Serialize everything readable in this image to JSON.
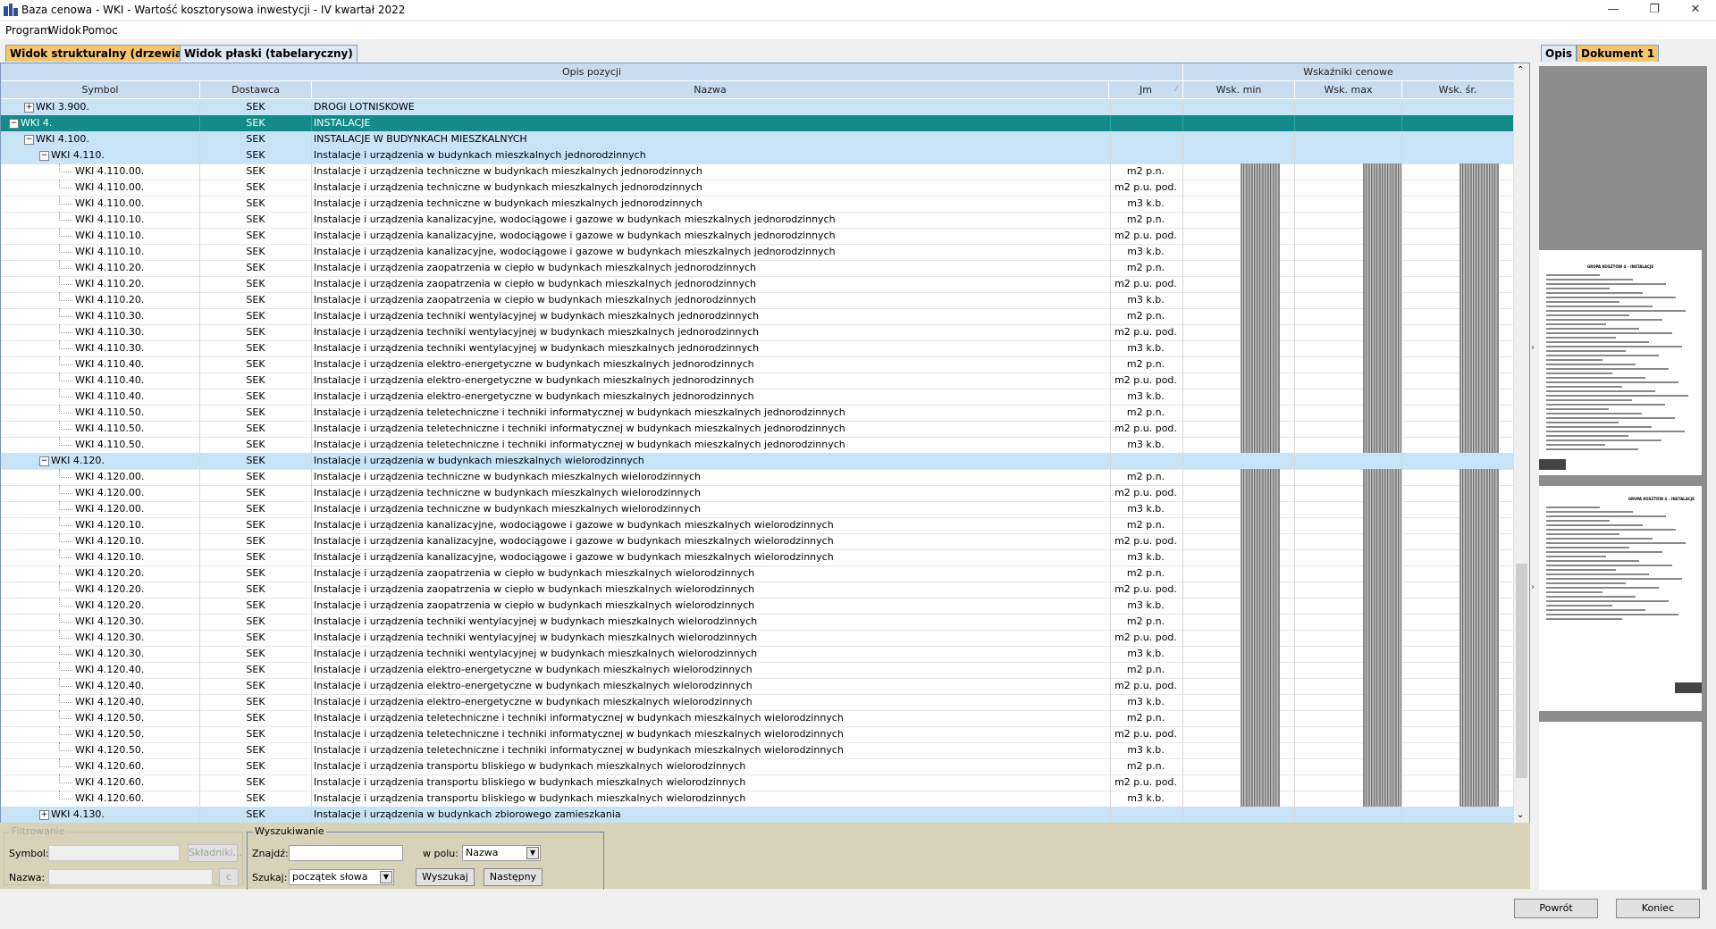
{
  "window": {
    "title": "Baza cenowa - WKI - Wartość kosztorysowa inwestycji - IV kwartał 2022",
    "minimize": "—",
    "restore": "❐",
    "close": "✕"
  },
  "menu": [
    "Program",
    "Widok",
    "Pomoc"
  ],
  "tabs": [
    {
      "label": "Widok strukturalny (drzewiasty)",
      "active": true
    },
    {
      "label": "Widok płaski (tabelaryczny)",
      "active": false
    }
  ],
  "grid": {
    "group_opis": "Opis pozycji",
    "group_wsk": "Wskaźniki cenowe",
    "columns": {
      "symbol": "Symbol",
      "dostawca": "Dostawca",
      "nazwa": "Nazwa",
      "jm": "Jm",
      "wsk_min": "Wsk. min",
      "wsk_max": "Wsk. max",
      "wsk_sr": "Wsk. śr."
    },
    "rows": [
      {
        "symbol": "WKI 3.900.",
        "dostawca": "SEK",
        "nazwa": "DROGI LOTNISKOWE",
        "jm": "",
        "level": 1,
        "type": "grp",
        "exp": "+"
      },
      {
        "symbol": "WKI 4.",
        "dostawca": "SEK",
        "nazwa": "INSTALACJE",
        "jm": "",
        "level": 0,
        "type": "sel",
        "exp": "−"
      },
      {
        "symbol": "WKI 4.100.",
        "dostawca": "SEK",
        "nazwa": "INSTALACJE W BUDYNKACH MIESZKALNYCH",
        "jm": "",
        "level": 1,
        "type": "grp",
        "exp": "−"
      },
      {
        "symbol": "WKI 4.110.",
        "dostawca": "SEK",
        "nazwa": "Instalacje i urządzenia w budynkach mieszkalnych jednorodzinnych",
        "jm": "",
        "level": 2,
        "type": "grp",
        "exp": "−"
      },
      {
        "symbol": "WKI 4.110.00.",
        "dostawca": "SEK",
        "nazwa": "Instalacje i urządzenia techniczne w budynkach mieszkalnych jednorodzinnych",
        "jm": "m2 p.n.",
        "level": 3,
        "type": "leaf"
      },
      {
        "symbol": "WKI 4.110.00.",
        "dostawca": "SEK",
        "nazwa": "Instalacje i urządzenia techniczne w budynkach mieszkalnych jednorodzinnych",
        "jm": "m2 p.u. pod.",
        "level": 3,
        "type": "leaf"
      },
      {
        "symbol": "WKI 4.110.00.",
        "dostawca": "SEK",
        "nazwa": "Instalacje i urządzenia techniczne w budynkach mieszkalnych jednorodzinnych",
        "jm": "m3 k.b.",
        "level": 3,
        "type": "leaf"
      },
      {
        "symbol": "WKI 4.110.10.",
        "dostawca": "SEK",
        "nazwa": "Instalacje i urządzenia kanalizacyjne, wodociągowe i gazowe w budynkach mieszkalnych jednorodzinnych",
        "jm": "m2 p.n.",
        "level": 3,
        "type": "leaf"
      },
      {
        "symbol": "WKI 4.110.10.",
        "dostawca": "SEK",
        "nazwa": "Instalacje i urządzenia kanalizacyjne, wodociągowe i gazowe w budynkach mieszkalnych jednorodzinnych",
        "jm": "m2 p.u. pod.",
        "level": 3,
        "type": "leaf"
      },
      {
        "symbol": "WKI 4.110.10.",
        "dostawca": "SEK",
        "nazwa": "Instalacje i urządzenia kanalizacyjne, wodociągowe i gazowe w budynkach mieszkalnych jednorodzinnych",
        "jm": "m3 k.b.",
        "level": 3,
        "type": "leaf"
      },
      {
        "symbol": "WKI 4.110.20.",
        "dostawca": "SEK",
        "nazwa": "Instalacje i urządzenia zaopatrzenia w ciepło w budynkach mieszkalnych jednorodzinnych",
        "jm": "m2 p.n.",
        "level": 3,
        "type": "leaf"
      },
      {
        "symbol": "WKI 4.110.20.",
        "dostawca": "SEK",
        "nazwa": "Instalacje i urządzenia zaopatrzenia w ciepło w budynkach mieszkalnych jednorodzinnych",
        "jm": "m2 p.u. pod.",
        "level": 3,
        "type": "leaf"
      },
      {
        "symbol": "WKI 4.110.20.",
        "dostawca": "SEK",
        "nazwa": "Instalacje i urządzenia zaopatrzenia w ciepło w budynkach mieszkalnych jednorodzinnych",
        "jm": "m3 k.b.",
        "level": 3,
        "type": "leaf"
      },
      {
        "symbol": "WKI 4.110.30.",
        "dostawca": "SEK",
        "nazwa": "Instalacje i urządzenia techniki wentylacyjnej w budynkach mieszkalnych jednorodzinnych",
        "jm": "m2 p.n.",
        "level": 3,
        "type": "leaf"
      },
      {
        "symbol": "WKI 4.110.30.",
        "dostawca": "SEK",
        "nazwa": "Instalacje i urządzenia techniki wentylacyjnej w budynkach mieszkalnych jednorodzinnych",
        "jm": "m2 p.u. pod.",
        "level": 3,
        "type": "leaf"
      },
      {
        "symbol": "WKI 4.110.30.",
        "dostawca": "SEK",
        "nazwa": "Instalacje i urządzenia techniki wentylacyjnej w budynkach mieszkalnych jednorodzinnych",
        "jm": "m3 k.b.",
        "level": 3,
        "type": "leaf"
      },
      {
        "symbol": "WKI 4.110.40.",
        "dostawca": "SEK",
        "nazwa": "Instalacje i urządzenia elektro-energetyczne w budynkach mieszkalnych jednorodzinnych",
        "jm": "m2 p.n.",
        "level": 3,
        "type": "leaf"
      },
      {
        "symbol": "WKI 4.110.40.",
        "dostawca": "SEK",
        "nazwa": "Instalacje i urządzenia elektro-energetyczne w budynkach mieszkalnych jednorodzinnych",
        "jm": "m2 p.u. pod.",
        "level": 3,
        "type": "leaf"
      },
      {
        "symbol": "WKI 4.110.40.",
        "dostawca": "SEK",
        "nazwa": "Instalacje i urządzenia elektro-energetyczne w budynkach mieszkalnych jednorodzinnych",
        "jm": "m3 k.b.",
        "level": 3,
        "type": "leaf"
      },
      {
        "symbol": "WKI 4.110.50.",
        "dostawca": "SEK",
        "nazwa": "Instalacje i urządzenia teletechniczne i techniki informatycznej w budynkach mieszkalnych jednorodzinnych",
        "jm": "m2 p.n.",
        "level": 3,
        "type": "leaf"
      },
      {
        "symbol": "WKI 4.110.50.",
        "dostawca": "SEK",
        "nazwa": "Instalacje i urządzenia teletechniczne i techniki informatycznej w budynkach mieszkalnych jednorodzinnych",
        "jm": "m2 p.u. pod.",
        "level": 3,
        "type": "leaf"
      },
      {
        "symbol": "WKI 4.110.50.",
        "dostawca": "SEK",
        "nazwa": "Instalacje i urządzenia teletechniczne i techniki informatycznej w budynkach mieszkalnych jednorodzinnych",
        "jm": "m3 k.b.",
        "level": 3,
        "type": "leaf"
      },
      {
        "symbol": "WKI 4.120.",
        "dostawca": "SEK",
        "nazwa": "Instalacje i urządzenia w budynkach mieszkalnych wielorodzinnych",
        "jm": "",
        "level": 2,
        "type": "grp",
        "exp": "−"
      },
      {
        "symbol": "WKI 4.120.00.",
        "dostawca": "SEK",
        "nazwa": "Instalacje i urządzenia techniczne w budynkach mieszkalnych wielorodzinnych",
        "jm": "m2 p.n.",
        "level": 3,
        "type": "leaf"
      },
      {
        "symbol": "WKI 4.120.00.",
        "dostawca": "SEK",
        "nazwa": "Instalacje i urządzenia techniczne w budynkach mieszkalnych wielorodzinnych",
        "jm": "m2 p.u. pod.",
        "level": 3,
        "type": "leaf"
      },
      {
        "symbol": "WKI 4.120.00.",
        "dostawca": "SEK",
        "nazwa": "Instalacje i urządzenia techniczne w budynkach mieszkalnych wielorodzinnych",
        "jm": "m3 k.b.",
        "level": 3,
        "type": "leaf"
      },
      {
        "symbol": "WKI 4.120.10.",
        "dostawca": "SEK",
        "nazwa": "Instalacje i urządzenia kanalizacyjne, wodociągowe i gazowe w budynkach mieszkalnych wielorodzinnych",
        "jm": "m2 p.n.",
        "level": 3,
        "type": "leaf"
      },
      {
        "symbol": "WKI 4.120.10.",
        "dostawca": "SEK",
        "nazwa": "Instalacje i urządzenia kanalizacyjne, wodociągowe i gazowe w budynkach mieszkalnych wielorodzinnych",
        "jm": "m2 p.u. pod.",
        "level": 3,
        "type": "leaf"
      },
      {
        "symbol": "WKI 4.120.10.",
        "dostawca": "SEK",
        "nazwa": "Instalacje i urządzenia kanalizacyjne, wodociągowe i gazowe w budynkach mieszkalnych wielorodzinnych",
        "jm": "m3 k.b.",
        "level": 3,
        "type": "leaf"
      },
      {
        "symbol": "WKI 4.120.20.",
        "dostawca": "SEK",
        "nazwa": "Instalacje i urządzenia zaopatrzenia w ciepło w budynkach mieszkalnych wielorodzinnych",
        "jm": "m2 p.n.",
        "level": 3,
        "type": "leaf"
      },
      {
        "symbol": "WKI 4.120.20.",
        "dostawca": "SEK",
        "nazwa": "Instalacje i urządzenia zaopatrzenia w ciepło w budynkach mieszkalnych wielorodzinnych",
        "jm": "m2 p.u. pod.",
        "level": 3,
        "type": "leaf"
      },
      {
        "symbol": "WKI 4.120.20.",
        "dostawca": "SEK",
        "nazwa": "Instalacje i urządzenia zaopatrzenia w ciepło w budynkach mieszkalnych wielorodzinnych",
        "jm": "m3 k.b.",
        "level": 3,
        "type": "leaf"
      },
      {
        "symbol": "WKI 4.120.30.",
        "dostawca": "SEK",
        "nazwa": "Instalacje i urządzenia techniki wentylacyjnej w budynkach mieszkalnych wielorodzinnych",
        "jm": "m2 p.n.",
        "level": 3,
        "type": "leaf"
      },
      {
        "symbol": "WKI 4.120.30.",
        "dostawca": "SEK",
        "nazwa": "Instalacje i urządzenia techniki wentylacyjnej w budynkach mieszkalnych wielorodzinnych",
        "jm": "m2 p.u. pod.",
        "level": 3,
        "type": "leaf"
      },
      {
        "symbol": "WKI 4.120.30.",
        "dostawca": "SEK",
        "nazwa": "Instalacje i urządzenia techniki wentylacyjnej w budynkach mieszkalnych wielorodzinnych",
        "jm": "m3 k.b.",
        "level": 3,
        "type": "leaf"
      },
      {
        "symbol": "WKI 4.120.40.",
        "dostawca": "SEK",
        "nazwa": "Instalacje i urządzenia elektro-energetyczne w budynkach mieszkalnych wielorodzinnych",
        "jm": "m2 p.n.",
        "level": 3,
        "type": "leaf"
      },
      {
        "symbol": "WKI 4.120.40.",
        "dostawca": "SEK",
        "nazwa": "Instalacje i urządzenia elektro-energetyczne w budynkach mieszkalnych wielorodzinnych",
        "jm": "m2 p.u. pod.",
        "level": 3,
        "type": "leaf"
      },
      {
        "symbol": "WKI 4.120.40.",
        "dostawca": "SEK",
        "nazwa": "Instalacje i urządzenia elektro-energetyczne w budynkach mieszkalnych wielorodzinnych",
        "jm": "m3 k.b.",
        "level": 3,
        "type": "leaf"
      },
      {
        "symbol": "WKI 4.120.50.",
        "dostawca": "SEK",
        "nazwa": "Instalacje i urządzenia teletechniczne i techniki informatycznej w budynkach mieszkalnych wielorodzinnych",
        "jm": "m2 p.n.",
        "level": 3,
        "type": "leaf"
      },
      {
        "symbol": "WKI 4.120.50.",
        "dostawca": "SEK",
        "nazwa": "Instalacje i urządzenia teletechniczne i techniki informatycznej w budynkach mieszkalnych wielorodzinnych",
        "jm": "m2 p.u. pod.",
        "level": 3,
        "type": "leaf"
      },
      {
        "symbol": "WKI 4.120.50.",
        "dostawca": "SEK",
        "nazwa": "Instalacje i urządzenia teletechniczne i techniki informatycznej w budynkach mieszkalnych wielorodzinnych",
        "jm": "m3 k.b.",
        "level": 3,
        "type": "leaf"
      },
      {
        "symbol": "WKI 4.120.60.",
        "dostawca": "SEK",
        "nazwa": "Instalacje i urządzenia transportu bliskiego w budynkach mieszkalnych wielorodzinnych",
        "jm": "m2 p.n.",
        "level": 3,
        "type": "leaf"
      },
      {
        "symbol": "WKI 4.120.60.",
        "dostawca": "SEK",
        "nazwa": "Instalacje i urządzenia transportu bliskiego w budynkach mieszkalnych wielorodzinnych",
        "jm": "m2 p.u. pod.",
        "level": 3,
        "type": "leaf"
      },
      {
        "symbol": "WKI 4.120.60.",
        "dostawca": "SEK",
        "nazwa": "Instalacje i urządzenia transportu bliskiego w budynkach mieszkalnych wielorodzinnych",
        "jm": "m3 k.b.",
        "level": 3,
        "type": "leaf"
      },
      {
        "symbol": "WKI 4.130.",
        "dostawca": "SEK",
        "nazwa": "Instalacje i urządzenia w budynkach zbiorowego zamieszkania",
        "jm": "",
        "level": 2,
        "type": "grp",
        "exp": "+"
      }
    ]
  },
  "filter": {
    "legend": "Filtrowanie",
    "symbol_label": "Symbol:",
    "symbol_value": "",
    "skladniki_label": "Składniki...",
    "nazwa_label": "Nazwa:",
    "nazwa_value": "",
    "clear_label": "c"
  },
  "search": {
    "legend": "Wyszukiwanie",
    "znajdz_label": "Znajdź:",
    "znajdz_value": "",
    "wpolu_label": "w polu:",
    "wpolu_value": "Nazwa",
    "szukaj_label": "Szukaj:",
    "szukaj_value": "początek słowa",
    "wyszukaj_label": "Wyszukaj",
    "nastepny_label": "Następny"
  },
  "right_tabs": [
    {
      "label": "Opis",
      "active": false
    },
    {
      "label": "Dokument 1",
      "active": true
    }
  ],
  "document_headings": [
    "GRUPA KOSZTÓW 4 – INSTALACJE",
    "GRUPA KOSZTÓW 4 – INSTALACJE"
  ],
  "footer": {
    "back_label": "Powrót",
    "end_label": "Koniec"
  }
}
